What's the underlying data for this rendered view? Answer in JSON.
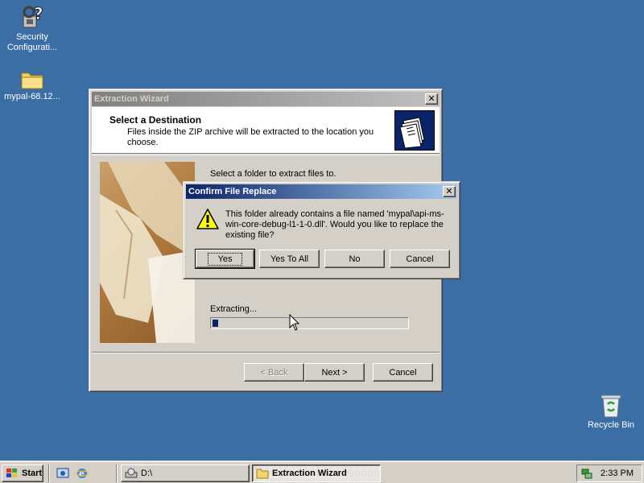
{
  "desktop": {
    "icons": [
      {
        "label": "Security\nConfigurati..."
      },
      {
        "label": "mypal-68.12..."
      },
      {
        "label": "Recycle Bin"
      }
    ]
  },
  "wizard": {
    "title": "Extraction Wizard",
    "header_title": "Select a Destination",
    "header_sub": "Files inside the ZIP archive will be extracted to the location you choose.",
    "select_folder_text": "Select a folder to extract files to.",
    "extracting_label": "Extracting...",
    "progress_percent": 3,
    "back_label": "< Back",
    "next_label": "Next >",
    "cancel_label": "Cancel"
  },
  "confirm": {
    "title": "Confirm File Replace",
    "message": "This folder already contains a file named 'mypal\\api-ms-win-core-debug-l1-1-0.dll'.  Would you like to replace the existing file?",
    "yes_label": "Yes",
    "yes_all_label": "Yes To All",
    "no_label": "No",
    "cancel_label": "Cancel"
  },
  "taskbar": {
    "start_label": "Start",
    "tasks": [
      {
        "label": "D:\\"
      },
      {
        "label": "Extraction Wizard"
      }
    ],
    "clock": "2:33 PM"
  },
  "colors": {
    "desktop": "#3a6ea5",
    "active_title": "#0a246a",
    "face": "#d4d0c8"
  }
}
